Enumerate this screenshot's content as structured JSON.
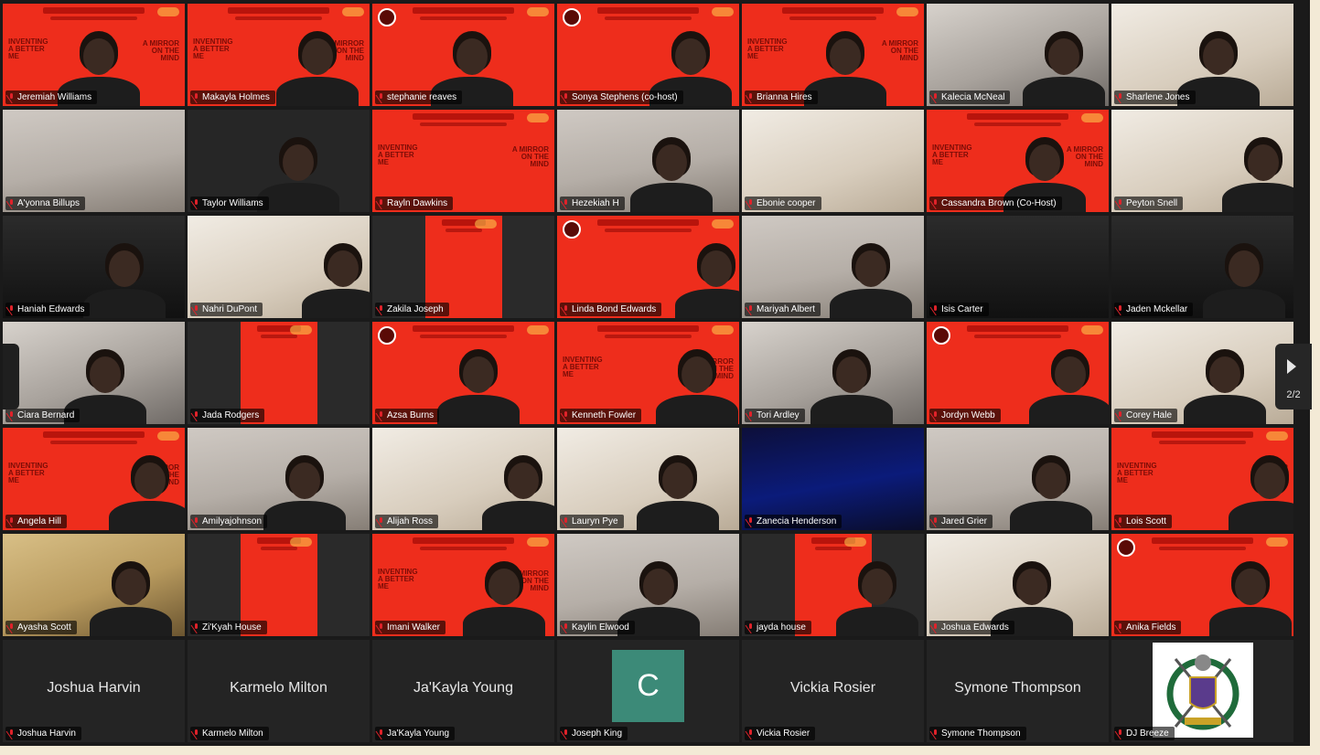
{
  "pagination": {
    "label": "2/2"
  },
  "participants": [
    {
      "name": "Jeremiah Williams",
      "bg": "slide",
      "person": true
    },
    {
      "name": "Makayla Holmes",
      "bg": "slide",
      "person": true
    },
    {
      "name": "stephanie reaves",
      "bg": "slide",
      "person": true
    },
    {
      "name": "Sonya Stephens (co-host)",
      "bg": "slide",
      "person": true
    },
    {
      "name": "Brianna Hires",
      "bg": "slide",
      "person": true
    },
    {
      "name": "Kalecia McNeal",
      "bg": "wall",
      "person": true
    },
    {
      "name": "Sharlene Jones",
      "bg": "beige",
      "person": true
    },
    {
      "name": "A'yonna Billups",
      "bg": "room",
      "person": false
    },
    {
      "name": "Taylor Williams",
      "bg": "purple",
      "person": true
    },
    {
      "name": "Rayln Dawkins",
      "bg": "slide",
      "person": false
    },
    {
      "name": "Hezekiah H",
      "bg": "room",
      "person": true
    },
    {
      "name": "Ebonie cooper",
      "bg": "beige",
      "person": false
    },
    {
      "name": "Cassandra Brown (Co-Host)",
      "bg": "slide",
      "person": true
    },
    {
      "name": "Peyton Snell",
      "bg": "beige",
      "person": true
    },
    {
      "name": "Haniah Edwards",
      "bg": "dark",
      "person": true
    },
    {
      "name": "Nahri DuPont",
      "bg": "beige",
      "person": true
    },
    {
      "name": "Zakila Joseph",
      "bg": "partial",
      "person": false
    },
    {
      "name": "Linda Bond Edwards",
      "bg": "slide",
      "person": true
    },
    {
      "name": "Mariyah Albert",
      "bg": "room",
      "person": true
    },
    {
      "name": "Isis Carter",
      "bg": "dark",
      "person": false
    },
    {
      "name": "Jaden Mckellar",
      "bg": "dark",
      "person": true
    },
    {
      "name": "Ciara Bernard",
      "bg": "wall",
      "person": true
    },
    {
      "name": "Jada Rodgers",
      "bg": "partial",
      "person": false
    },
    {
      "name": "Azsa Burns",
      "bg": "slide",
      "person": true
    },
    {
      "name": "Kenneth Fowler",
      "bg": "slide",
      "person": true
    },
    {
      "name": "Tori Ardley",
      "bg": "wall",
      "person": true
    },
    {
      "name": "Jordyn Webb",
      "bg": "slide",
      "person": true
    },
    {
      "name": "Corey Hale",
      "bg": "beige",
      "person": true
    },
    {
      "name": "Angela Hill",
      "bg": "slide",
      "person": true
    },
    {
      "name": "Amilyajohnson",
      "bg": "room",
      "person": true
    },
    {
      "name": "Alijah Ross",
      "bg": "beige",
      "person": true
    },
    {
      "name": "Lauryn Pye",
      "bg": "beige",
      "person": true
    },
    {
      "name": "Zanecia Henderson",
      "bg": "navy",
      "person": false
    },
    {
      "name": "Jared Grier",
      "bg": "room",
      "person": true
    },
    {
      "name": "Lois Scott",
      "bg": "slide",
      "person": true
    },
    {
      "name": "Ayasha Scott",
      "bg": "gold",
      "person": true
    },
    {
      "name": "Zi'Kyah House",
      "bg": "partial",
      "person": false
    },
    {
      "name": "Imani Walker",
      "bg": "slide",
      "person": true
    },
    {
      "name": "Kaylin Elwood",
      "bg": "room",
      "person": true
    },
    {
      "name": "jayda house",
      "bg": "partial",
      "person": true
    },
    {
      "name": "Joshua Edwards",
      "bg": "beige",
      "person": true
    },
    {
      "name": "Anika Fields",
      "bg": "slide",
      "person": true
    },
    {
      "name": "Joshua Harvin",
      "bg": "empty",
      "display": "Joshua Harvin"
    },
    {
      "name": "Karmelo Milton",
      "bg": "empty",
      "display": "Karmelo Milton"
    },
    {
      "name": "Ja'Kayla Young",
      "bg": "empty",
      "display": "Ja'Kayla Young"
    },
    {
      "name": "Joseph King",
      "bg": "empty",
      "avatar": "C",
      "avatar_color": "#3c8a78"
    },
    {
      "name": "Vickia Rosier",
      "bg": "empty",
      "display": "Vickia Rosier"
    },
    {
      "name": "Symone Thompson",
      "bg": "empty",
      "display": "Symone Thompson"
    },
    {
      "name": "DJ Breeze",
      "bg": "empty",
      "logo": true
    }
  ],
  "slide_text": {
    "left": "INVENTING\nA BETTER\nME",
    "right": "A MIRROR\nON THE\nMIND"
  },
  "colors": {
    "slide_red": "#ee2d1c",
    "muted_mic": "#e0222a",
    "avatar_teal": "#3c8a78"
  }
}
